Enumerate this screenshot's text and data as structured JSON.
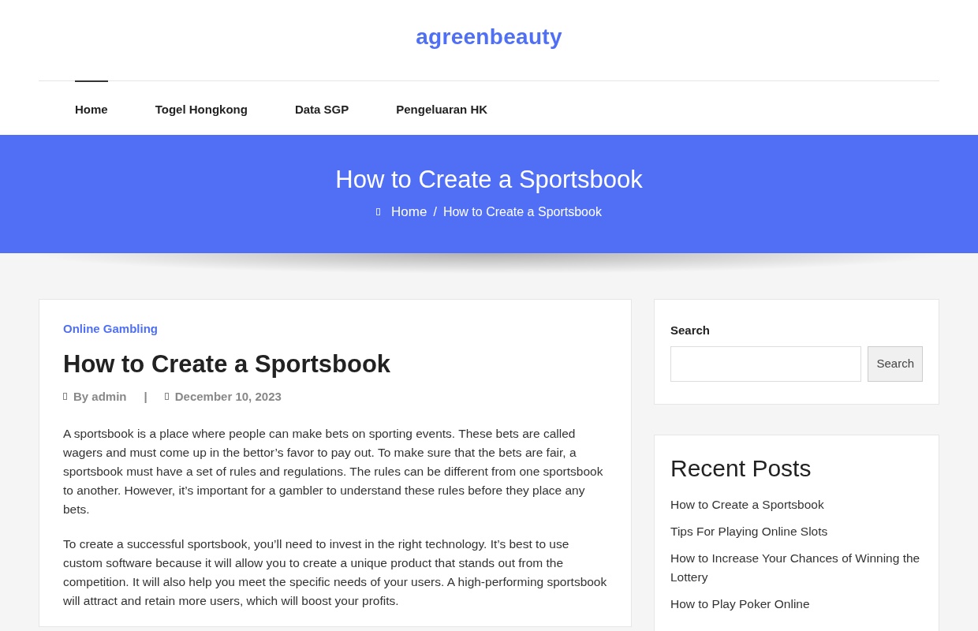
{
  "site_title": "agreenbeauty",
  "nav": [
    {
      "label": "Home",
      "selected": true
    },
    {
      "label": "Togel Hongkong",
      "selected": false
    },
    {
      "label": "Data SGP",
      "selected": false
    },
    {
      "label": "Pengeluaran HK",
      "selected": false
    }
  ],
  "hero": {
    "title": "How to Create a Sportsbook",
    "breadcrumb": [
      "Home",
      "How to Create a Sportsbook"
    ],
    "breadcrumb_separator": "/"
  },
  "post": {
    "category": "Online Gambling",
    "title": "How to Create a Sportsbook",
    "author": "By admin",
    "separator": "|",
    "date": "December 10, 2023",
    "paragraphs": [
      "A sportsbook is a place where people can make bets on sporting events. These bets are called wagers and must come up in the bettor’s favor to pay out. To make sure that the bets are fair, a sportsbook must have a set of rules and regulations. The rules can be different from one sportsbook to another. However, it’s important for a gambler to understand these rules before they place any bets.",
      "To create a successful sportsbook, you’ll need to invest in the right technology. It’s best to use custom software because it will allow you to create a unique product that stands out from the competition. It will also help you meet the specific needs of your users. A high-performing sportsbook will attract and retain more users, which will boost your profits."
    ]
  },
  "sidebar": {
    "search": {
      "label": "Search",
      "button": "Search"
    },
    "recent": {
      "title": "Recent Posts",
      "items": [
        "How to Create a Sportsbook",
        "Tips For Playing Online Slots",
        "How to Increase Your Chances of Winning the Lottery",
        "How to Play Poker Online"
      ]
    }
  }
}
